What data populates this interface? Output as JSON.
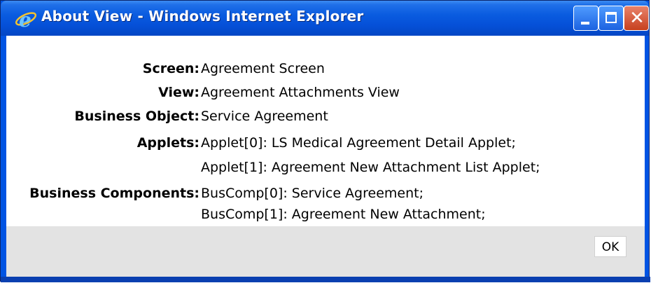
{
  "window": {
    "title": "About View - Windows Internet Explorer",
    "icon": "internet-explorer-icon"
  },
  "details": {
    "screen_label": "Screen:",
    "screen_value": "Agreement Screen",
    "view_label": "View:",
    "view_value": "Agreement Attachments View",
    "business_object_label": "Business Object:",
    "business_object_value": "Service Agreement",
    "applets_label": "Applets:",
    "applets": [
      "Applet[0]: LS Medical Agreement Detail Applet;",
      "Applet[1]: Agreement New Attachment List Applet;"
    ],
    "business_components_label": "Business Components:",
    "business_components": [
      "BusComp[0]: Service Agreement;",
      "BusComp[1]: Agreement New Attachment;"
    ]
  },
  "footer": {
    "ok_label": "OK"
  },
  "colors": {
    "titlebar": "#0a5ce0",
    "close_button": "#c6401e",
    "footer_background": "#e3e3e3"
  }
}
